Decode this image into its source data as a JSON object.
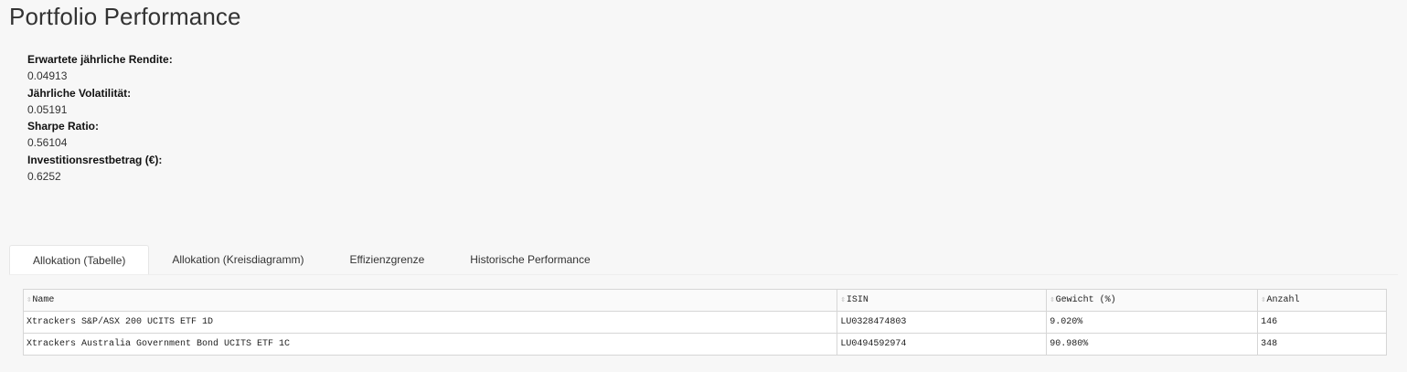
{
  "title": "Portfolio Performance",
  "metrics": [
    {
      "label": "Erwartete jährliche Rendite:",
      "value": "0.04913"
    },
    {
      "label": "Jährliche Volatilität:",
      "value": "0.05191"
    },
    {
      "label": "Sharpe Ratio:",
      "value": "0.56104"
    },
    {
      "label": "Investitionsrestbetrag (€):",
      "value": "0.6252"
    }
  ],
  "tabs": [
    {
      "label": "Allokation (Tabelle)",
      "active": true
    },
    {
      "label": "Allokation (Kreisdiagramm)",
      "active": false
    },
    {
      "label": "Effizienzgrenze",
      "active": false
    },
    {
      "label": "Historische Performance",
      "active": false
    }
  ],
  "table": {
    "sort_icon": "sort-icon",
    "headers": [
      "Name",
      "ISIN",
      "Gewicht (%)",
      "Anzahl"
    ],
    "rows": [
      [
        "Xtrackers S&P/ASX 200 UCITS ETF 1D",
        "LU0328474803",
        "9.020%",
        "146"
      ],
      [
        "Xtrackers Australia Government Bond UCITS ETF 1C",
        "LU0494592974",
        "90.980%",
        "348"
      ]
    ]
  }
}
